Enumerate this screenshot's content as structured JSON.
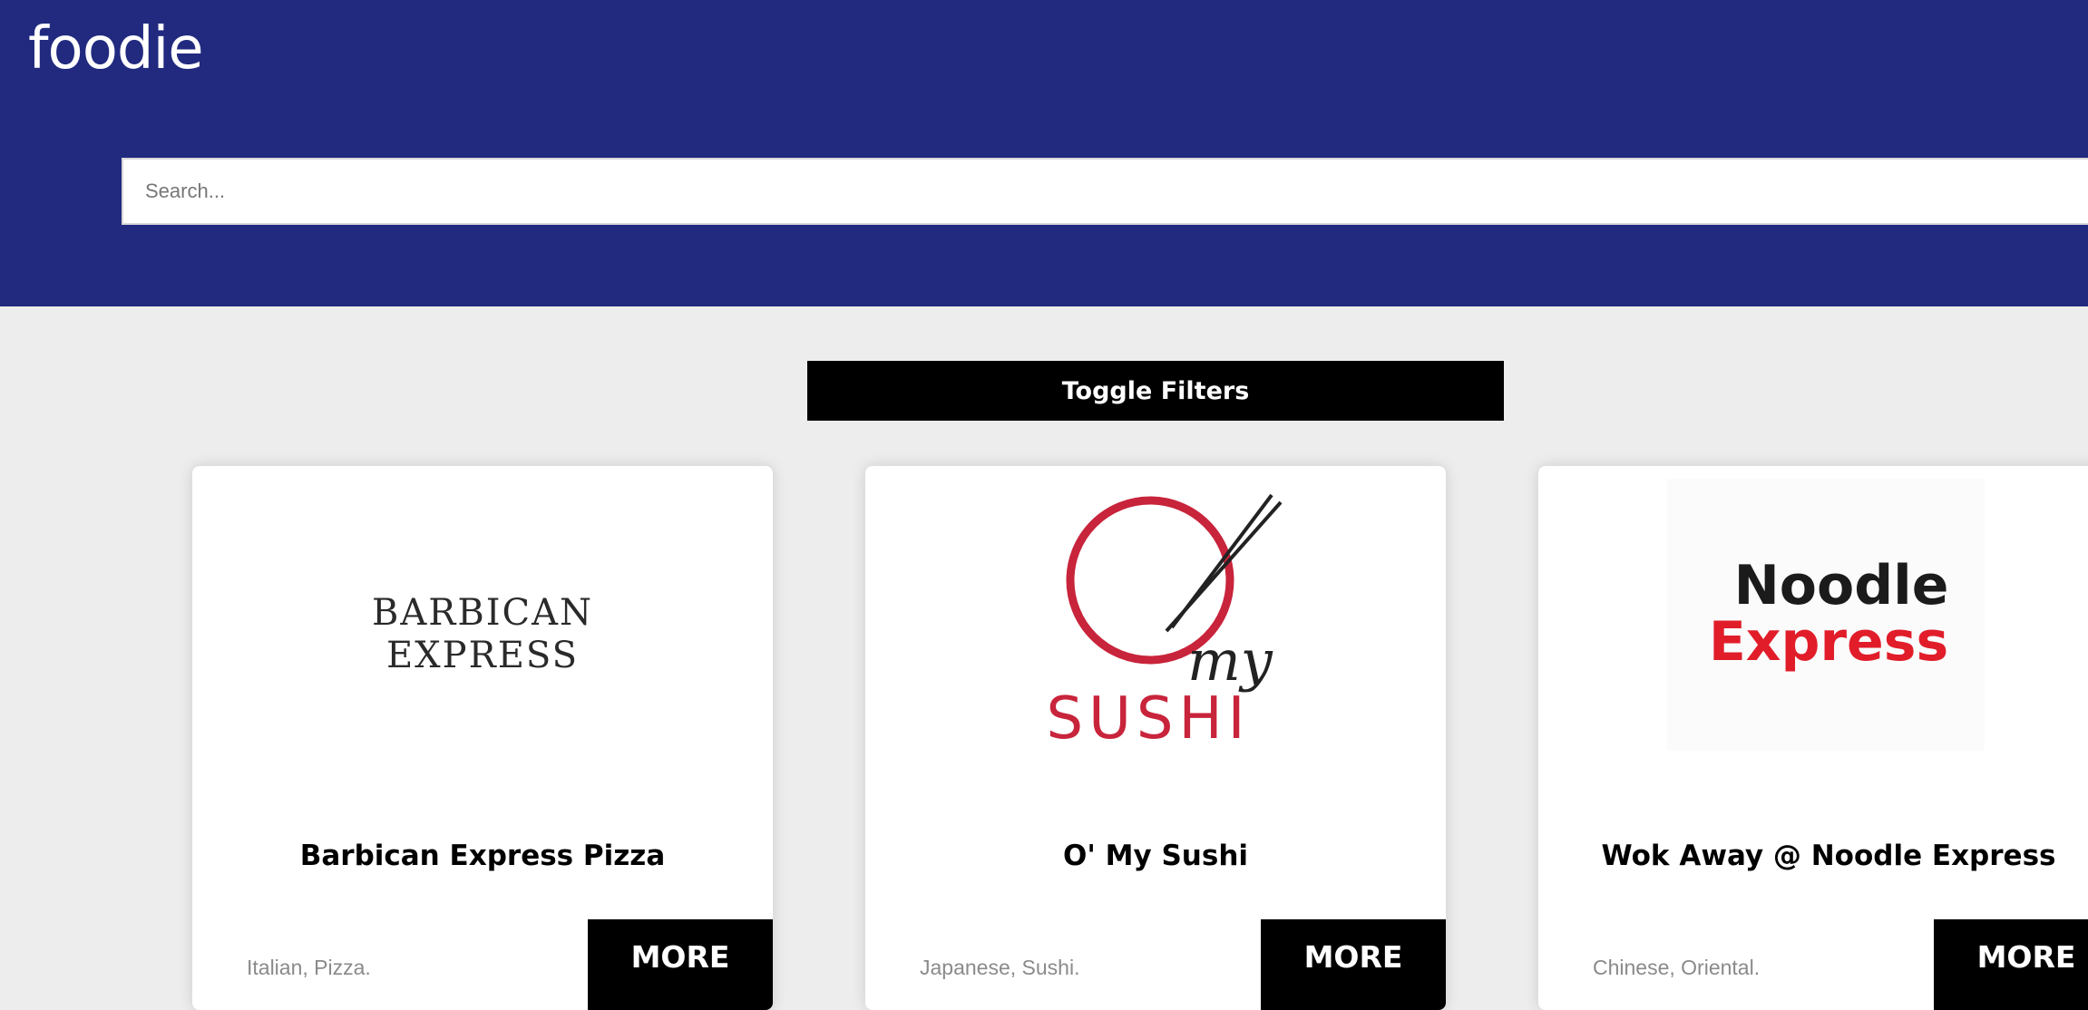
{
  "brand": "foodie",
  "search": {
    "placeholder": "Search..."
  },
  "toggle_filters_label": "Toggle Filters",
  "restaurants": [
    {
      "name": "Barbican Express Pizza",
      "tags": "Italian, Pizza.",
      "more_label": "MORE",
      "logo_text": [
        "BARBICAN",
        "EXPRESS"
      ]
    },
    {
      "name": "O' My Sushi",
      "tags": "Japanese, Sushi.",
      "more_label": "MORE",
      "logo_text": [
        "my",
        "SUSHI"
      ]
    },
    {
      "name": "Wok Away @ Noodle Express",
      "tags": "Chinese, Oriental.",
      "more_label": "MORE",
      "logo_text": [
        "Noodle",
        "Express"
      ]
    }
  ],
  "colors": {
    "header_bg": "#212a7f",
    "page_bg": "#ededed",
    "sushi_red": "#c8243b",
    "noodle_red": "#e11d2a"
  }
}
